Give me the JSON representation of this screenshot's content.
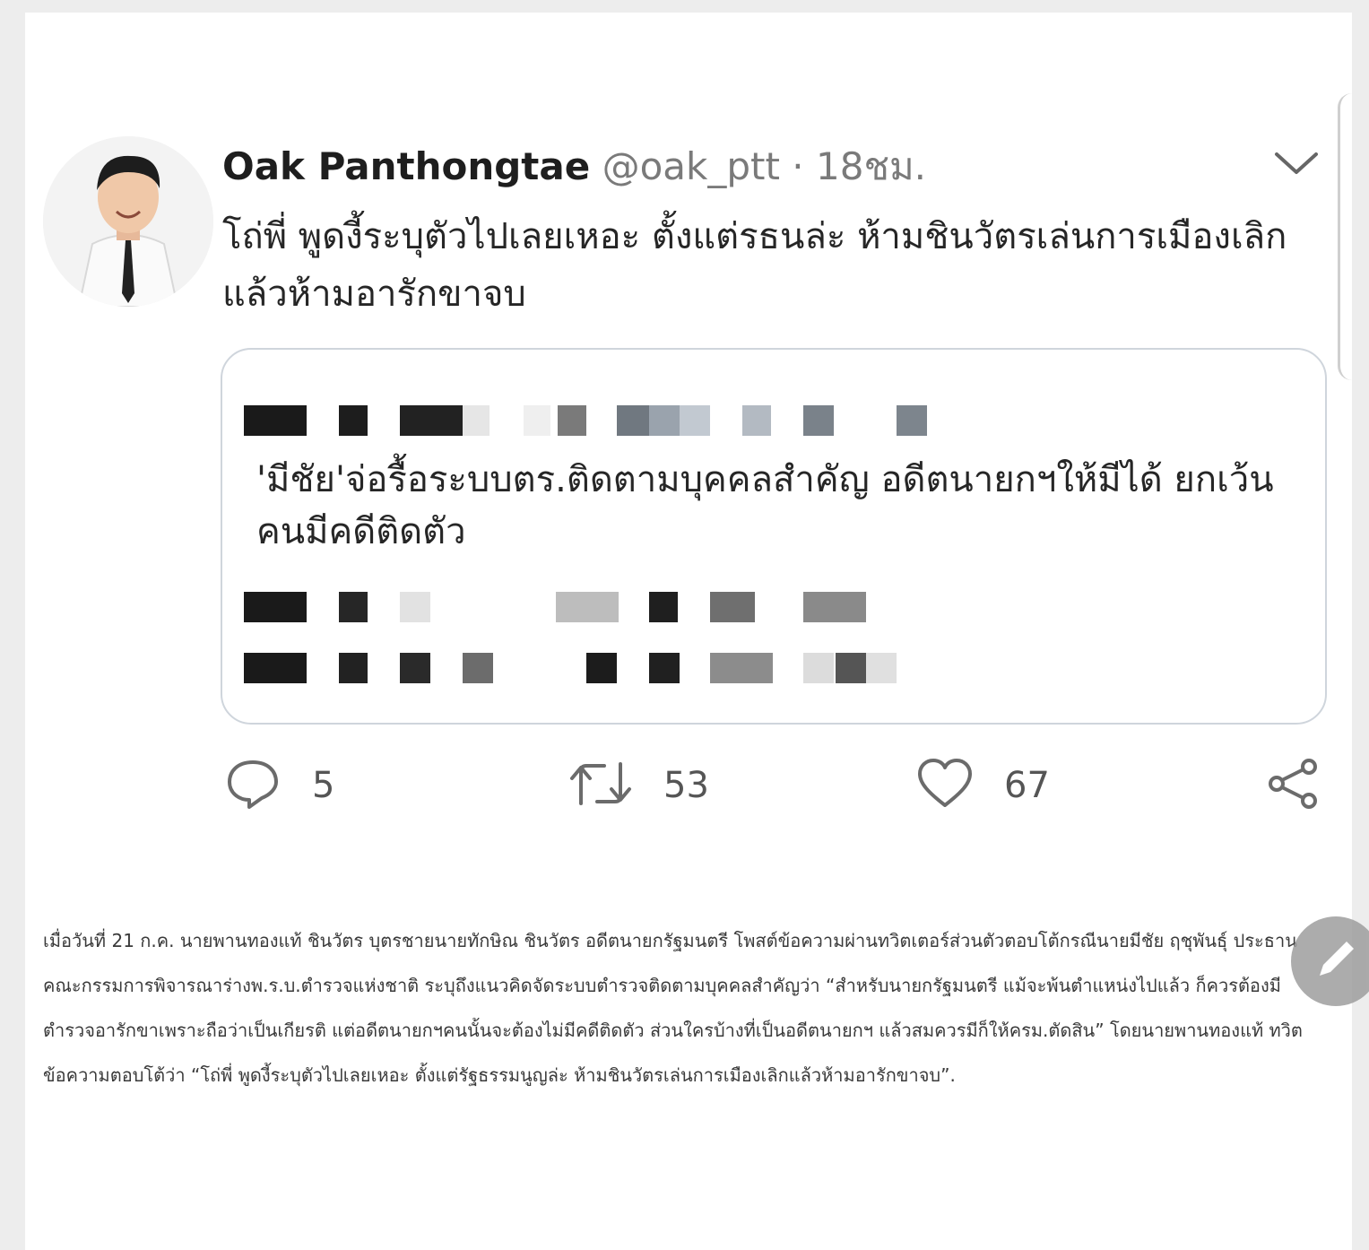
{
  "tweet": {
    "display_name": "Oak Panthongtae",
    "handle": "@oak_ptt",
    "separator": "·",
    "time": "18ชม.",
    "text": "โถ่พี่ พูดงี้ระบุตัวไปเลยเหอะ ตั้งแต่รธนล่ะ ห้ามชินวัตรเล่นการเมืองเลิกแล้วห้ามอารักขาจบ",
    "quoted_headline": "'มีชัย'จ่อรื้อระบบตร.ติดตามบุคคลสำคัญ อดีตนายกฯให้มีได้ ยกเว้นคนมีคดีติดตัว",
    "reply_count": "5",
    "retweet_count": "53",
    "like_count": "67",
    "icons": {
      "menu": "chevron-down-icon",
      "reply": "reply-icon",
      "retweet": "retweet-icon",
      "like": "heart-icon",
      "share": "share-icon"
    }
  },
  "article": {
    "paragraph": "เมื่อวันที่ 21 ก.ค. นายพานทองแท้ ชินวัตร บุตรชายนายทักษิณ ชินวัตร อดีตนายกรัฐมนตรี โพสต์ข้อความผ่านทวิตเตอร์ส่วนตัวตอบโต้กรณีนายมีชัย ฤชุพันธุ์ ประธานคณะกรรมการพิจารณาร่างพ.ร.บ.ตำรวจแห่งชาติ ระบุถึงแนวคิดจัดระบบตำรวจติดตามบุคคลสำคัญว่า “สำหรับนายกรัฐมนตรี แม้จะพ้นตำแหน่งไปแล้ว ก็ควรต้องมีตำรวจอารักขาเพราะถือว่าเป็นเกียรติ แต่อดีตนายกฯคนนั้นจะต้องไม่มีคดีติดตัว ส่วนใครบ้างที่เป็นอดีตนายกฯ แล้วสมควรมีก็ให้ครม.ตัดสิน” โดยนายพานทองแท้ ทวิตข้อความตอบโต้ว่า “โถ่พี่ พูดงี้ระบุตัวไปเลยเหอะ ตั้งแต่รัฐธรรมนูญล่ะ ห้ามชินวัตรเล่นการเมืองเลิกแล้วห้ามอารักขาจบ”."
  },
  "floating_button_icon": "pencil-icon",
  "colors": {
    "page_background": "#ededed",
    "card_background": "#ffffff",
    "muted_text": "#7a7a7a",
    "border": "#cfd5dc"
  }
}
